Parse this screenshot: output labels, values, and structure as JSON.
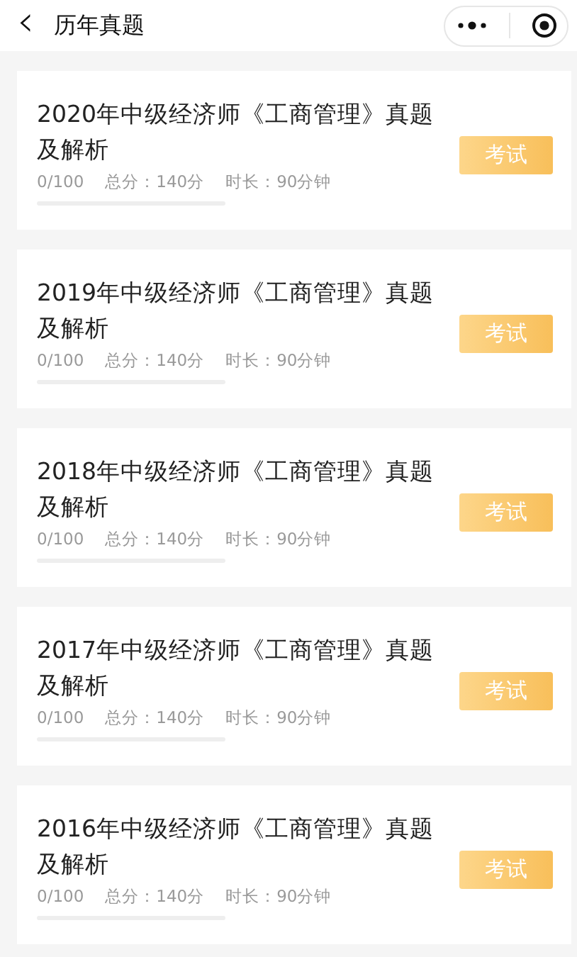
{
  "header": {
    "back": "‹",
    "title": "历年真题"
  },
  "exams": [
    {
      "title": "2020年中级经济师《工商管理》真题及解析",
      "progress": "0/100",
      "score": "总分：140分",
      "duration": "时长：90分钟",
      "level": 0,
      "button": "考试"
    },
    {
      "title": "2019年中级经济师《工商管理》真题及解析",
      "progress": "0/100",
      "score": "总分：140分",
      "duration": "时长：90分钟",
      "level": 0,
      "button": "考试"
    },
    {
      "title": "2018年中级经济师《工商管理》真题及解析",
      "progress": "0/100",
      "score": "总分：140分",
      "duration": "时长：90分钟",
      "level": 0,
      "button": "考试"
    },
    {
      "title": "2017年中级经济师《工商管理》真题及解析",
      "progress": "0/100",
      "score": "总分：140分",
      "duration": "时长：90分钟",
      "level": 0,
      "button": "考试"
    },
    {
      "title": "2016年中级经济师《工商管理》真题及解析",
      "progress": "0/100",
      "score": "总分：140分",
      "duration": "时长：90分钟",
      "level": 0,
      "button": "考试"
    }
  ]
}
